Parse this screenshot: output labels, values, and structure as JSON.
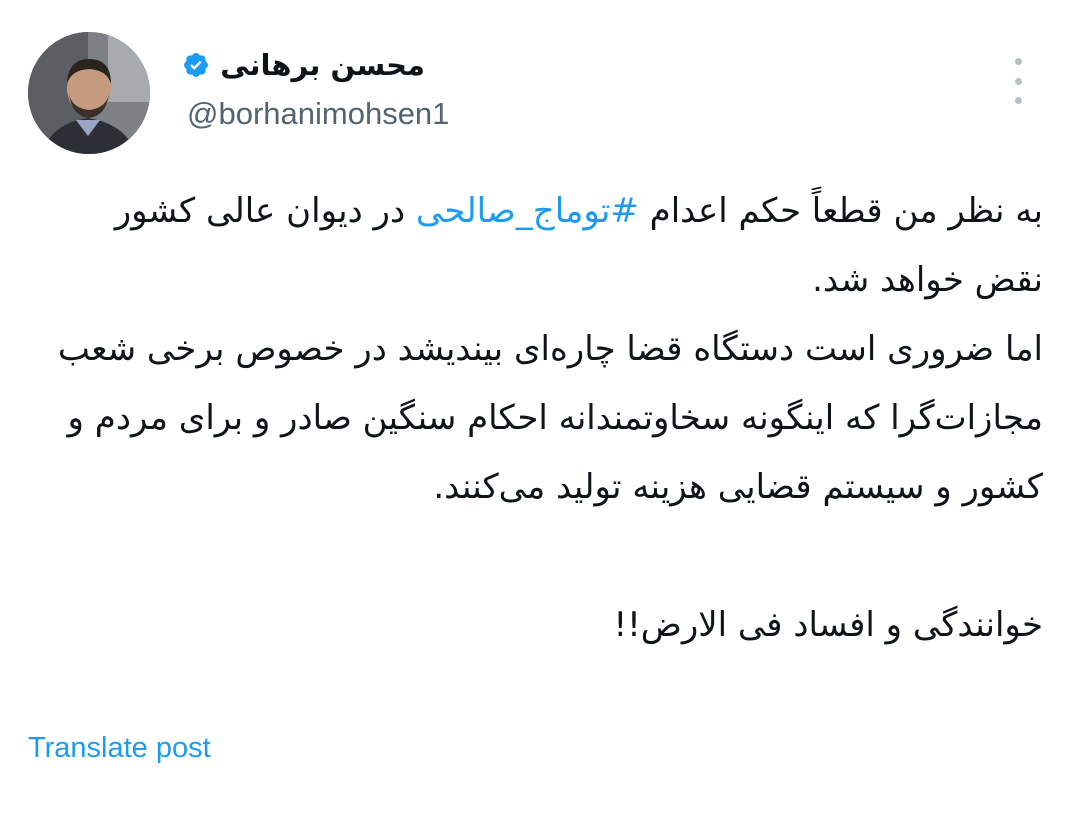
{
  "author": {
    "display_name": "محسن برهانی",
    "handle": "@borhanimohsen1",
    "verified_icon": "verified-badge-icon",
    "avatar": "profile-photo"
  },
  "menu": {
    "icon": "more-options-icon"
  },
  "tweet": {
    "line1_before": "به نظر من قطعاً حکم اعدام",
    "hashtag": "#توماج_صالحی",
    "line1_after": "در دیوان عالی کشور نقض خواهد شد.",
    "paragraph2": "اما ضروری است دستگاه قضا چاره‌ای بیندیشد در خصوص برخی شعب مجازات‌گرا که اینگونه سخاوتمندانه احکام سنگین صادر و برای مردم و کشور و سیستم قضایی هزینه تولید می‌کنند.",
    "paragraph3": "خوانندگی و افساد فی الارض!!"
  },
  "actions": {
    "translate_label": "Translate post"
  },
  "colors": {
    "link": "#1d9bf0",
    "text": "#0f1419",
    "muted": "#536471",
    "verified": "#1d9bf0"
  }
}
